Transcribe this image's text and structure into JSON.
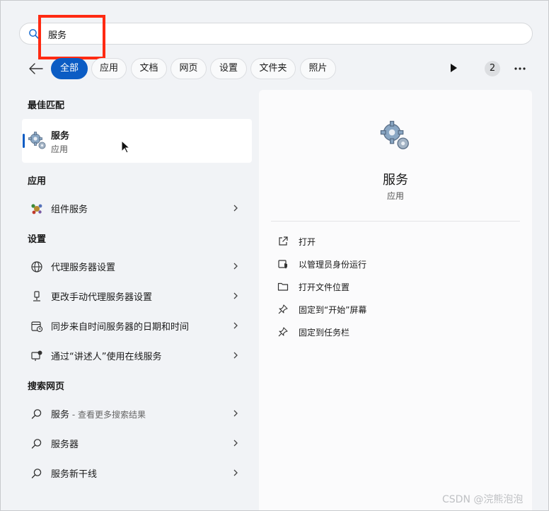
{
  "search": {
    "query": "服务"
  },
  "filters": {
    "chips": [
      "全部",
      "应用",
      "文档",
      "网页",
      "设置",
      "文件夹",
      "照片"
    ],
    "count": "2"
  },
  "best_match": {
    "section": "最佳匹配",
    "title": "服务",
    "subtitle": "应用"
  },
  "apps": {
    "section": "应用",
    "items": [
      {
        "label": "组件服务"
      }
    ]
  },
  "settings": {
    "section": "设置",
    "items": [
      {
        "label": "代理服务器设置"
      },
      {
        "label": "更改手动代理服务器设置"
      },
      {
        "label": "同步来自时间服务器的日期和时间"
      },
      {
        "label": "通过“讲述人”使用在线服务"
      }
    ]
  },
  "web": {
    "section": "搜索网页",
    "items": [
      {
        "label": "服务",
        "suffix": " - 查看更多搜索结果"
      },
      {
        "label": "服务器"
      },
      {
        "label": "服务新干线"
      }
    ]
  },
  "detail": {
    "title": "服务",
    "subtitle": "应用",
    "actions": [
      {
        "label": "打开"
      },
      {
        "label": "以管理员身份运行"
      },
      {
        "label": "打开文件位置"
      },
      {
        "label": "固定到“开始”屏幕"
      },
      {
        "label": "固定到任务栏"
      }
    ]
  },
  "watermark": "CSDN @浣熊泡泡",
  "colors": {
    "accent": "#0b5cc4",
    "highlight_box": "#ff2a12"
  }
}
